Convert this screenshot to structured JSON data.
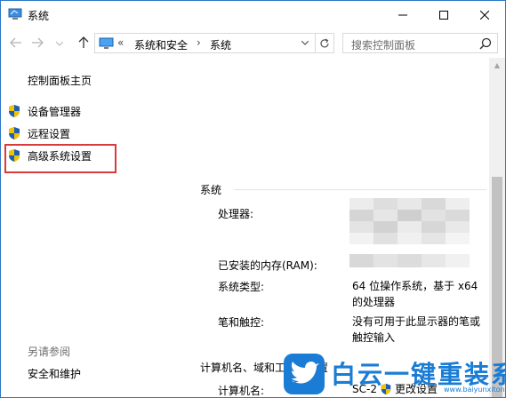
{
  "window": {
    "title": "系统"
  },
  "nav": {
    "breadcrumb_prefix": "«",
    "breadcrumb": [
      "系统和安全",
      "系统"
    ],
    "breadcrumb_sep": "›",
    "search_placeholder": "搜索控制面板"
  },
  "left_pane": {
    "home_link": "控制面板主页",
    "tasks": [
      {
        "label": "设备管理器"
      },
      {
        "label": "远程设置"
      },
      {
        "label": "高级系统设置"
      }
    ],
    "see_also_header": "另请参阅",
    "see_also_links": [
      "安全和维护"
    ]
  },
  "system_section": {
    "title": "系统",
    "rows": [
      {
        "label": "处理器:",
        "value": ""
      },
      {
        "label": "已安装的内存(RAM):",
        "value": ""
      },
      {
        "label": "系统类型:",
        "value_lines": [
          "64 位操作系统，基于 x64",
          "的处理器"
        ]
      },
      {
        "label": "笔和触控:",
        "value_lines": [
          "没有可用于此显示器的笔或",
          "触控输入"
        ]
      }
    ]
  },
  "computer_section": {
    "title": "计算机名、域和工作组设置",
    "rows": [
      {
        "label": "计算机名:",
        "value": "SC-2"
      }
    ],
    "change_settings": "更改设置"
  },
  "watermark": {
    "text": "白云一键重装系统",
    "url": "www.baiyunxitong.com"
  },
  "colors": {
    "accent": "#2b78c5",
    "highlight_box": "#d83b3b",
    "watermark_blue": "#1a7cd4"
  }
}
